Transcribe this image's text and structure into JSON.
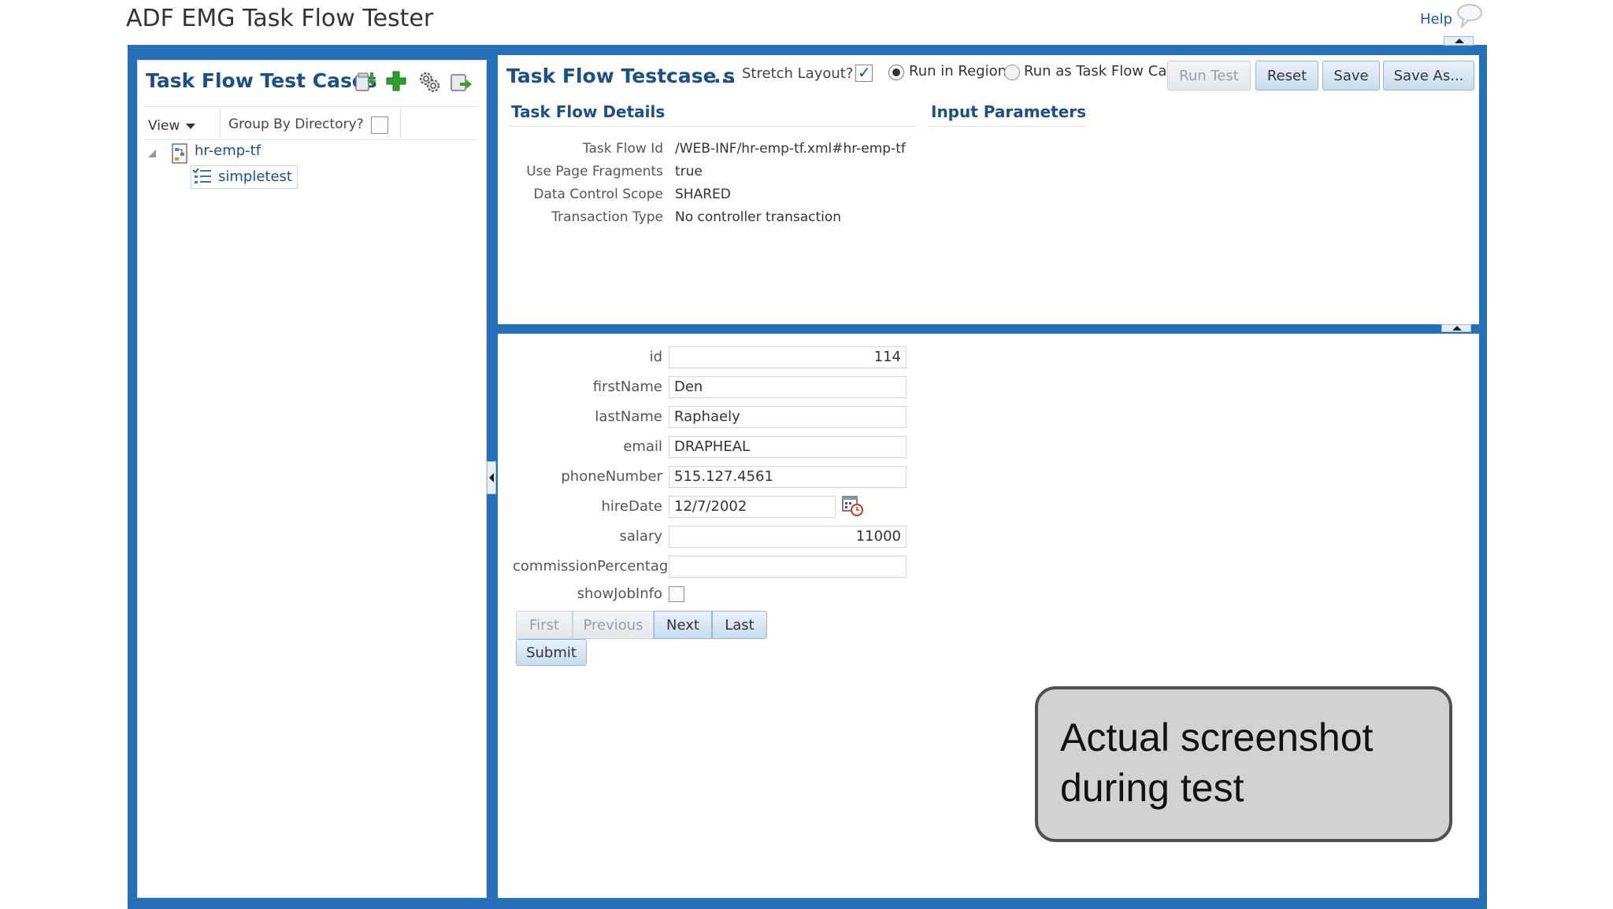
{
  "app": {
    "title": "ADF EMG Task Flow Tester",
    "help_label": "Help"
  },
  "left_panel": {
    "title": "Task Flow Test Cases",
    "toolbar_icons": [
      "import-icon",
      "add-icon",
      "settings-icon",
      "export-icon"
    ],
    "view_menu_label": "View",
    "group_by_label": "Group By Directory?",
    "group_by_checked": false,
    "tree": {
      "node_label": "hr-emp-tf",
      "child_label": "simpletest"
    }
  },
  "right_top": {
    "title": "Task Flow Testcase sir",
    "title_ellipsis": "...",
    "stretch_label": "Stretch Layout?",
    "stretch_checked": true,
    "run_mode_options": [
      "Run in Region",
      "Run as Task Flow Call"
    ],
    "run_mode_selected": "Run in Region",
    "buttons": {
      "run_test": "Run Test",
      "reset": "Reset",
      "save": "Save",
      "save_as": "Save As..."
    },
    "details_heading": "Task Flow Details",
    "input_heading": "Input Parameters",
    "details": [
      {
        "label": "Task Flow Id",
        "value": "/WEB-INF/hr-emp-tf.xml#hr-emp-tf"
      },
      {
        "label": "Use Page Fragments",
        "value": "true"
      },
      {
        "label": "Data Control Scope",
        "value": "SHARED"
      },
      {
        "label": "Transaction Type",
        "value": "No controller transaction"
      }
    ]
  },
  "form": {
    "fields": [
      {
        "label": "id",
        "value": "114"
      },
      {
        "label": "firstName",
        "value": "Den"
      },
      {
        "label": "lastName",
        "value": "Raphaely"
      },
      {
        "label": "email",
        "value": "DRAPHEAL"
      },
      {
        "label": "phoneNumber",
        "value": "515.127.4561"
      },
      {
        "label": "hireDate",
        "value": "12/7/2002"
      },
      {
        "label": "salary",
        "value": "11000"
      },
      {
        "label": "commissionPercentage",
        "value": ""
      },
      {
        "label": "showJobInfo",
        "value": ""
      }
    ],
    "nav": {
      "first": "First",
      "previous": "Previous",
      "next": "Next",
      "last": "Last"
    },
    "submit_label": "Submit"
  },
  "callout": {
    "line1": "Actual screenshot",
    "line2": "during test"
  },
  "colors": {
    "frame_blue": "#2570b8",
    "heading_blue": "#1c4f86",
    "link_blue": "#1f4f8c"
  }
}
